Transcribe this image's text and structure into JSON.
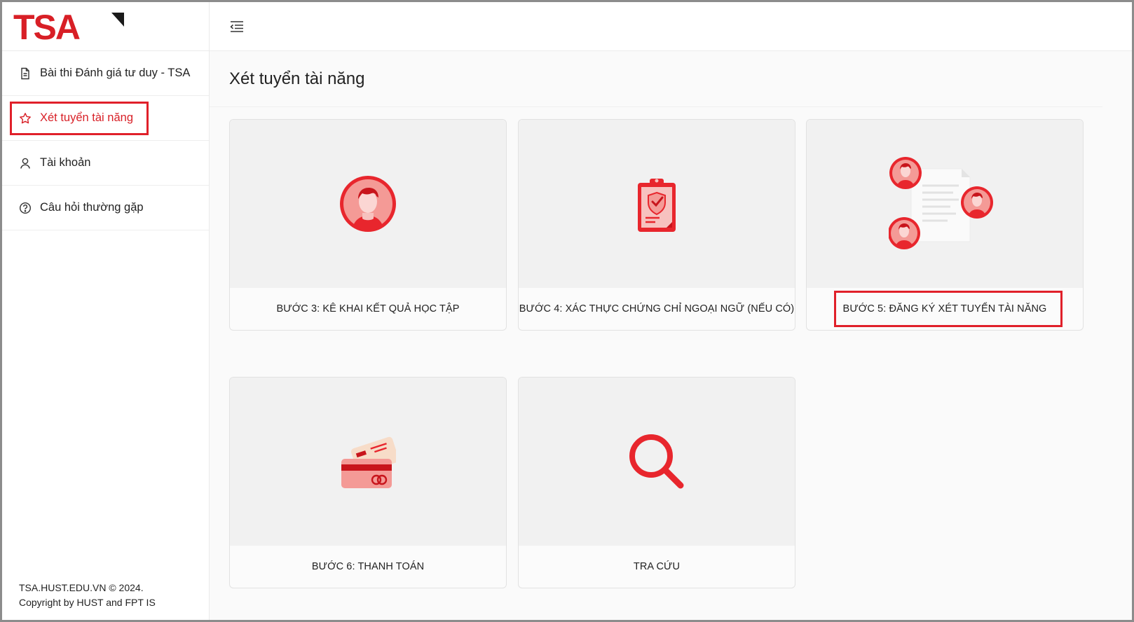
{
  "brand": {
    "logo_text": "TSA"
  },
  "sidebar": {
    "items": [
      {
        "label": "Bài thi Đánh giá tư duy - TSA",
        "icon": "document-icon"
      },
      {
        "label": "Xét tuyển tài năng",
        "icon": "star-icon"
      },
      {
        "label": "Tài khoản",
        "icon": "user-icon"
      },
      {
        "label": "Câu hỏi thường gặp",
        "icon": "help-circle-icon"
      }
    ],
    "active_index": 1
  },
  "footer": {
    "line1": "TSA.HUST.EDU.VN © 2024.",
    "line2": "Copyright by HUST and FPT IS"
  },
  "header": {
    "menu_icon": "menu-collapse-icon"
  },
  "page": {
    "title": "Xét tuyển tài năng"
  },
  "cards": [
    {
      "label": "BƯỚC 3: KÊ KHAI KẾT QUẢ HỌC TẬP",
      "icon": "student-avatar-icon"
    },
    {
      "label": "BƯỚC 4: XÁC THỰC CHỨNG CHỈ NGOẠI NGỮ (NẾU CÓ)",
      "icon": "clipboard-check-icon"
    },
    {
      "label": "BƯỚC 5: ĐĂNG KÝ XÉT TUYỂN TÀI NĂNG",
      "icon": "team-document-icon"
    },
    {
      "label": "BƯỚC 6: THANH TOÁN",
      "icon": "credit-card-icon"
    },
    {
      "label": "TRA CỨU",
      "icon": "search-icon"
    }
  ],
  "colors": {
    "brand_red": "#d81f26",
    "highlight": "#e0202a",
    "soft_red": "#f49a96"
  }
}
